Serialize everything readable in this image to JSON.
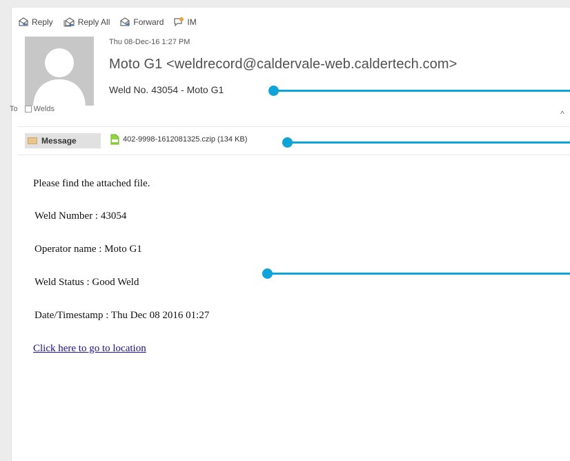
{
  "toolbar": {
    "reply": "Reply",
    "reply_all": "Reply All",
    "forward": "Forward",
    "im": "IM"
  },
  "header": {
    "date": "Thu 08-Dec-16 1:27 PM",
    "sender": "Moto G1 <weldrecord@caldervale-web.caldertech.com>",
    "subject": "Weld No. 43054 - Moto G1",
    "to_label": "To",
    "to_recipient": "Welds"
  },
  "attachments": {
    "message_tab": "Message",
    "file": "402-9998-1612081325.czip (134 KB)"
  },
  "body": {
    "line1": "Please find the attached file.",
    "line2": "Weld Number : 43054",
    "line3": "Operator name : Moto G1",
    "line4": "Weld Status : Good Weld",
    "line5": "Date/Timestamp : Thu Dec 08 2016 01:27",
    "link": "Click here to go to location"
  },
  "colors": {
    "callout": "#0ba5da",
    "link": "#1a0dab",
    "attachment_icon": "#7ed321"
  },
  "icons": [
    "reply-icon",
    "reply-all-icon",
    "forward-icon",
    "im-icon",
    "avatar-placeholder",
    "mail-icon",
    "attachment-file-icon",
    "chevron-up-icon"
  ]
}
